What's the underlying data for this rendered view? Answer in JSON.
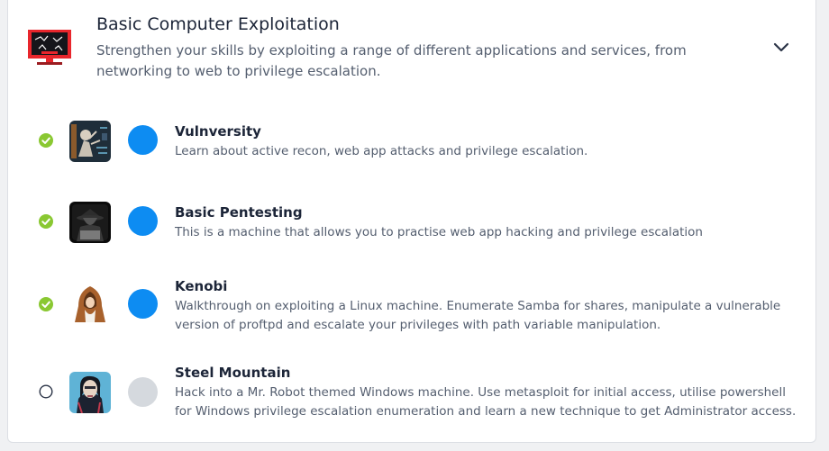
{
  "module": {
    "title": "Basic Computer Exploitation",
    "description": "Strengthen your skills by exploiting a range of different applications and services, from networking to web to privilege escalation.",
    "icon": "monitor-icon",
    "collapse_icon": "chevron-down-icon"
  },
  "colors": {
    "complete": "#8ac832",
    "progress": "#0d8cf2",
    "incomplete": "#d5d9de"
  },
  "rooms": [
    {
      "title": "Vulnversity",
      "description": "Learn about active recon, web app attacks and privilege escalation.",
      "completed": true,
      "icon": "vulnversity-room-icon"
    },
    {
      "title": "Basic Pentesting",
      "description": "This is a machine that allows you to practise web app hacking and privilege escalation",
      "completed": true,
      "icon": "hacker-room-icon"
    },
    {
      "title": "Kenobi",
      "description": "Walkthrough on exploiting a Linux machine. Enumerate Samba for shares, manipulate a vulnerable version of proftpd and escalate your privileges with path variable manipulation.",
      "completed": true,
      "icon": "hooded-figure-room-icon"
    },
    {
      "title": "Steel Mountain",
      "description": "Hack into a Mr. Robot themed Windows machine. Use metasploit for initial access, utilise powershell for Windows privilege escalation enumeration and learn a new technique to get Administrator access.",
      "completed": false,
      "icon": "mr-robot-room-icon"
    }
  ]
}
